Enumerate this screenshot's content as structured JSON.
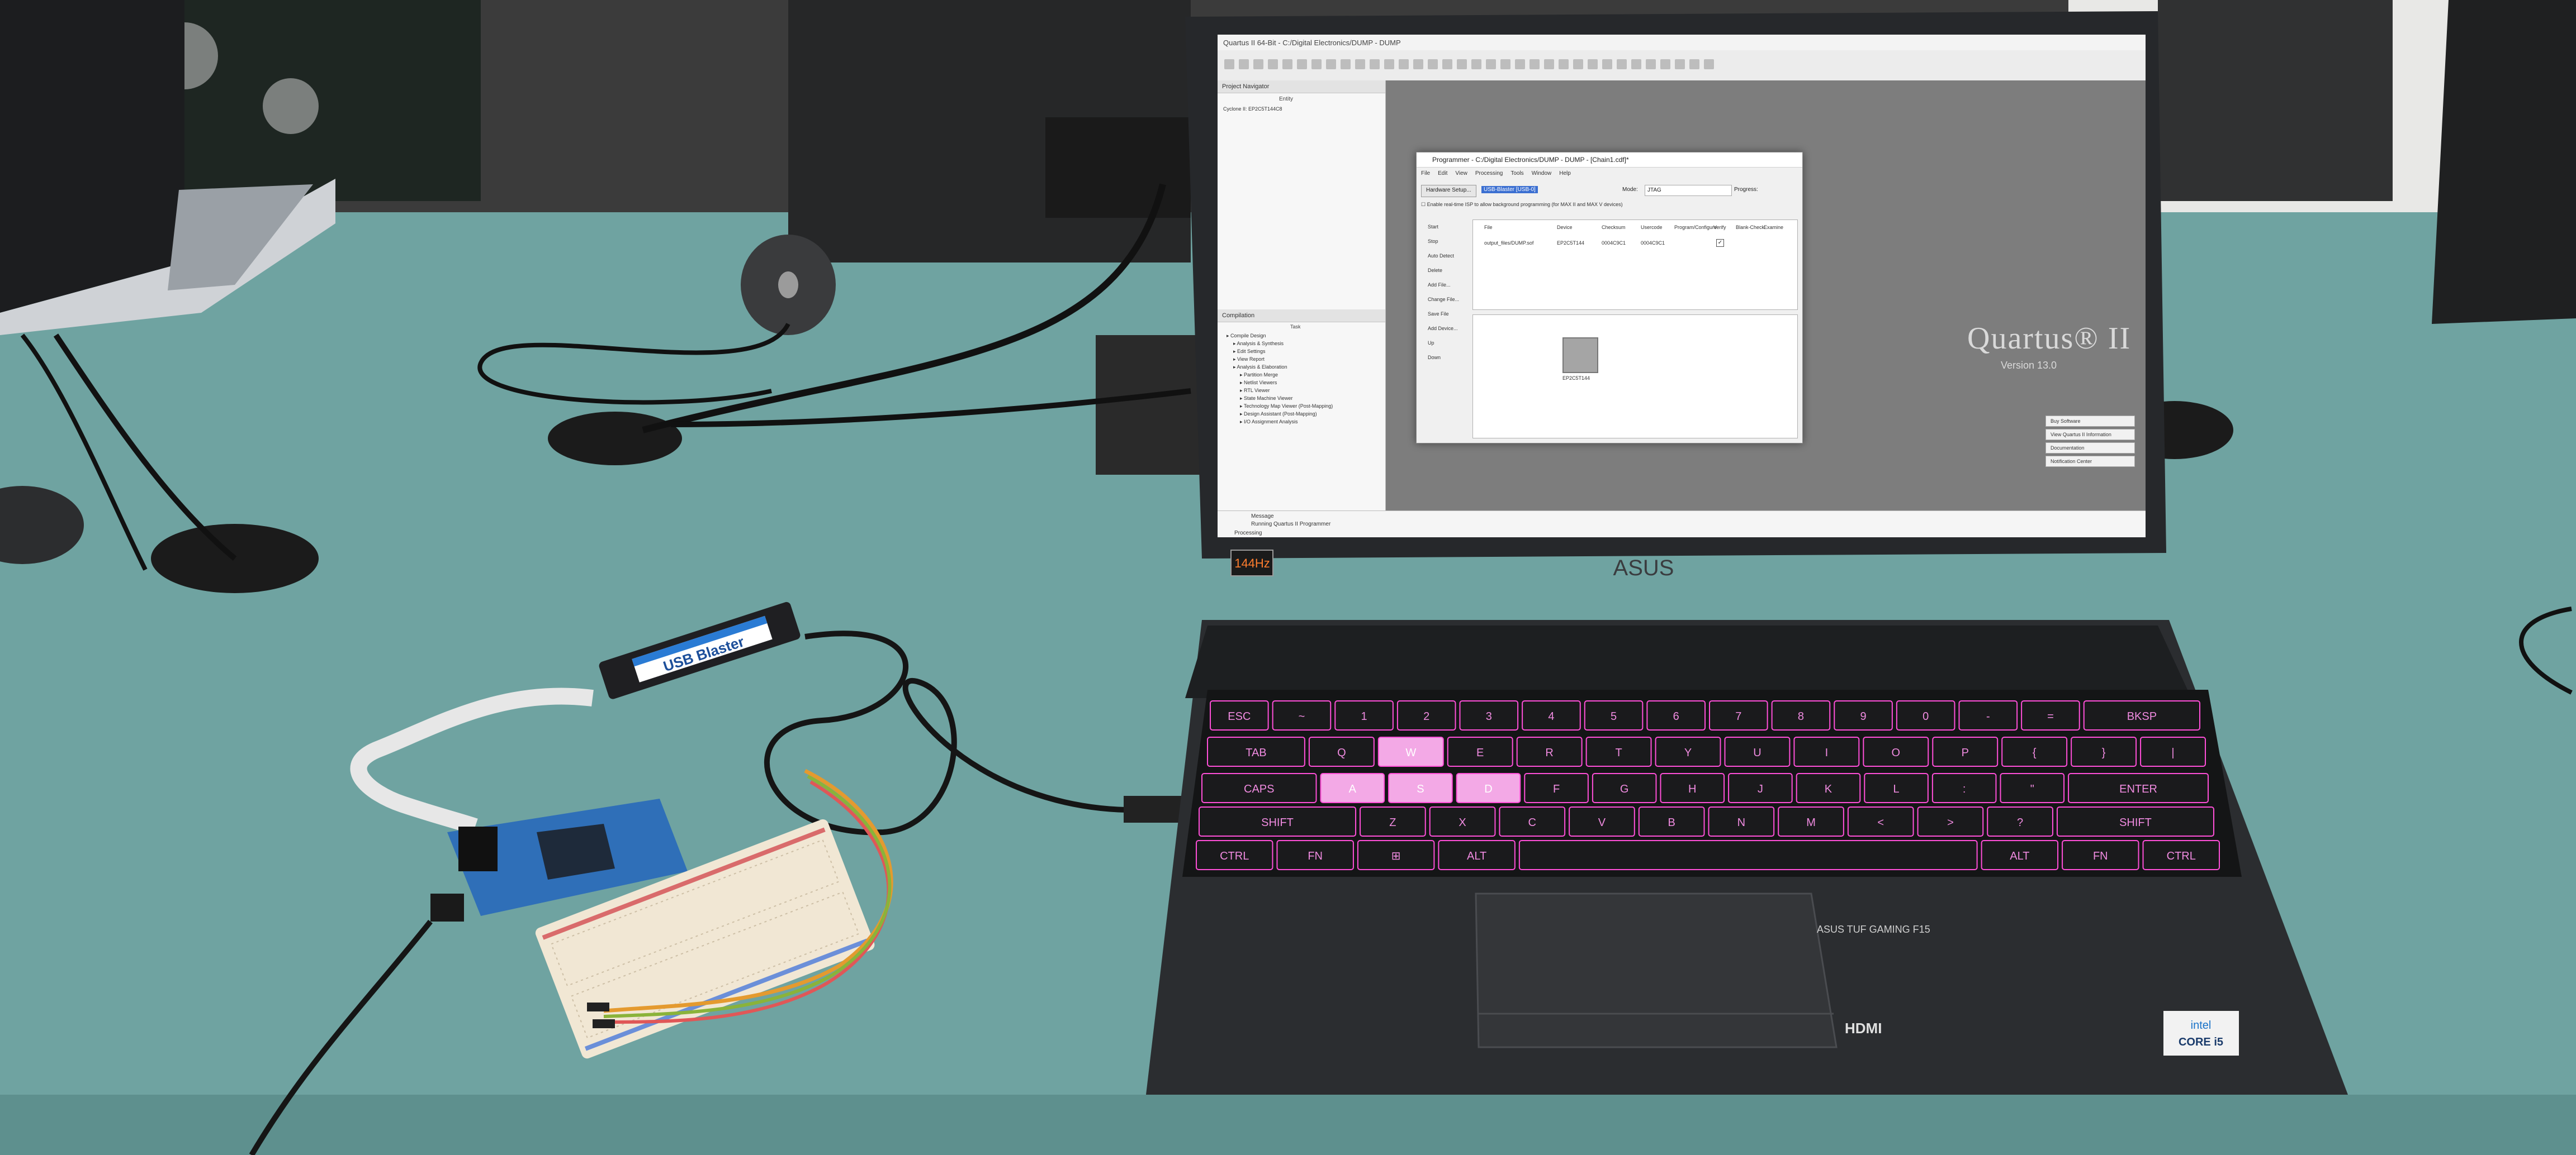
{
  "screen": {
    "window_title": "Quartus II 64-Bit - C:/Digital Electronics/DUMP - DUMP",
    "toolbar_count": 34,
    "project_navigator": "Project Navigator",
    "entity": "Entity",
    "device": "Cyclone II: EP2C5T144C8",
    "tasks_header": "Task",
    "flow": "Compilation",
    "tasks": [
      "Compile Design",
      "Analysis & Synthesis",
      "Edit Settings",
      "View Report",
      "Analysis & Elaboration",
      "Partition Merge",
      "Netlist Viewers",
      "RTL Viewer",
      "State Machine Viewer",
      "Technology Map Viewer (Post-Mapping)",
      "Design Assistant (Post-Mapping)",
      "I/O Assignment Analysis"
    ],
    "brand": "Quartus® II",
    "version": "Version 13.0",
    "side_buttons": [
      "Buy Software",
      "View Quartus II Information",
      "Documentation",
      "Notification Center"
    ],
    "messages_header": "Message",
    "message": "Running Quartus II Programmer",
    "processing_tab": "Processing"
  },
  "programmer": {
    "title": "Programmer - C:/Digital Electronics/DUMP - DUMP - [Chain1.cdf]*",
    "menu": [
      "File",
      "Edit",
      "View",
      "Processing",
      "Tools",
      "Window",
      "Help"
    ],
    "hardware_setup": "Hardware Setup...",
    "hardware_value": "USB-Blaster [USB-0]",
    "mode_label": "Mode:",
    "mode_value": "JTAG",
    "progress_label": "Progress:",
    "start_button": "Start",
    "checkbox_label": "Enable real-time ISP to allow background programming (for MAX II and MAX V devices)",
    "side_buttons": [
      "Start",
      "Stop",
      "Auto Detect",
      "Delete",
      "Add File...",
      "Change File...",
      "Save File",
      "Add Device...",
      "Up",
      "Down"
    ],
    "columns": [
      "File",
      "Device",
      "Checksum",
      "Usercode",
      "Program/Configure",
      "Verify",
      "Blank-Check",
      "Examine"
    ],
    "row": [
      "output_files/DUMP.sof",
      "EP2C5T144",
      "0004C9C1",
      "0004C9C1"
    ],
    "chip_label": "EP2C5T144"
  },
  "laptop": {
    "logo": "ASUS",
    "badge": "144Hz",
    "model": "ASUS TUF GAMING F15",
    "hdmi": "HDMI",
    "cpu_brand": "intel",
    "cpu_model": "CORE i5"
  },
  "usb_blaster": {
    "label": "USB Blaster"
  },
  "keyboard": {
    "row1": [
      "ESC",
      "~",
      "1",
      "2",
      "3",
      "4",
      "5",
      "6",
      "7",
      "8",
      "9",
      "0",
      "-",
      "=",
      "BKSP"
    ],
    "row2": [
      "TAB",
      "Q",
      "W",
      "E",
      "R",
      "T",
      "Y",
      "U",
      "I",
      "O",
      "P",
      "{",
      "}",
      "|"
    ],
    "row3": [
      "CAPS",
      "A",
      "S",
      "D",
      "F",
      "G",
      "H",
      "J",
      "K",
      "L",
      ":",
      "\"",
      "ENTER"
    ],
    "row4": [
      "SHIFT",
      "Z",
      "X",
      "C",
      "V",
      "B",
      "N",
      "M",
      "<",
      ">",
      "?",
      "SHIFT"
    ],
    "row5": [
      "CTRL",
      "FN",
      "⊞",
      "ALT",
      "",
      "ALT",
      "FN",
      "CTRL"
    ]
  },
  "colors": {
    "desk": "#6fa3a1",
    "laptop_body": "#2b2d30",
    "backlight": "#ff4fd8"
  }
}
